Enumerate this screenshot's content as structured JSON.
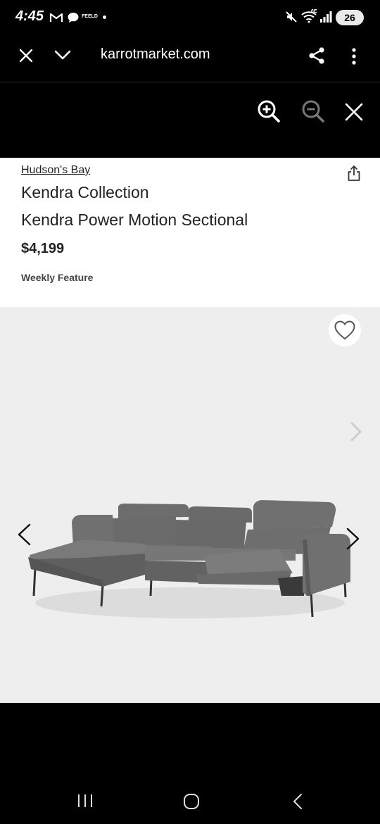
{
  "status_bar": {
    "time": "4:45",
    "notification_icons": [
      "gmail-icon",
      "chat-icon",
      "feeld-icon",
      "dot-icon"
    ],
    "feeld_label": "FEELD",
    "system_icons": [
      "mute-icon",
      "wifi-icon",
      "signal-icon"
    ],
    "wifi_badge": "6E",
    "battery": "26"
  },
  "browser": {
    "url": "karrotmarket.com",
    "icons": [
      "close-icon",
      "chevron-down-icon",
      "share-icon",
      "more-icon"
    ]
  },
  "zoom_toolbar": {
    "icons": [
      "zoom-in-icon",
      "zoom-out-icon",
      "close-icon"
    ]
  },
  "product": {
    "brand": "Hudson's Bay",
    "collection": "Kendra Collection",
    "name": "Kendra Power Motion Sectional",
    "price": "$4,199",
    "feature": "Weekly Feature"
  },
  "nav_bar": {
    "icons": [
      "recent-apps-icon",
      "home-icon",
      "back-icon"
    ]
  }
}
